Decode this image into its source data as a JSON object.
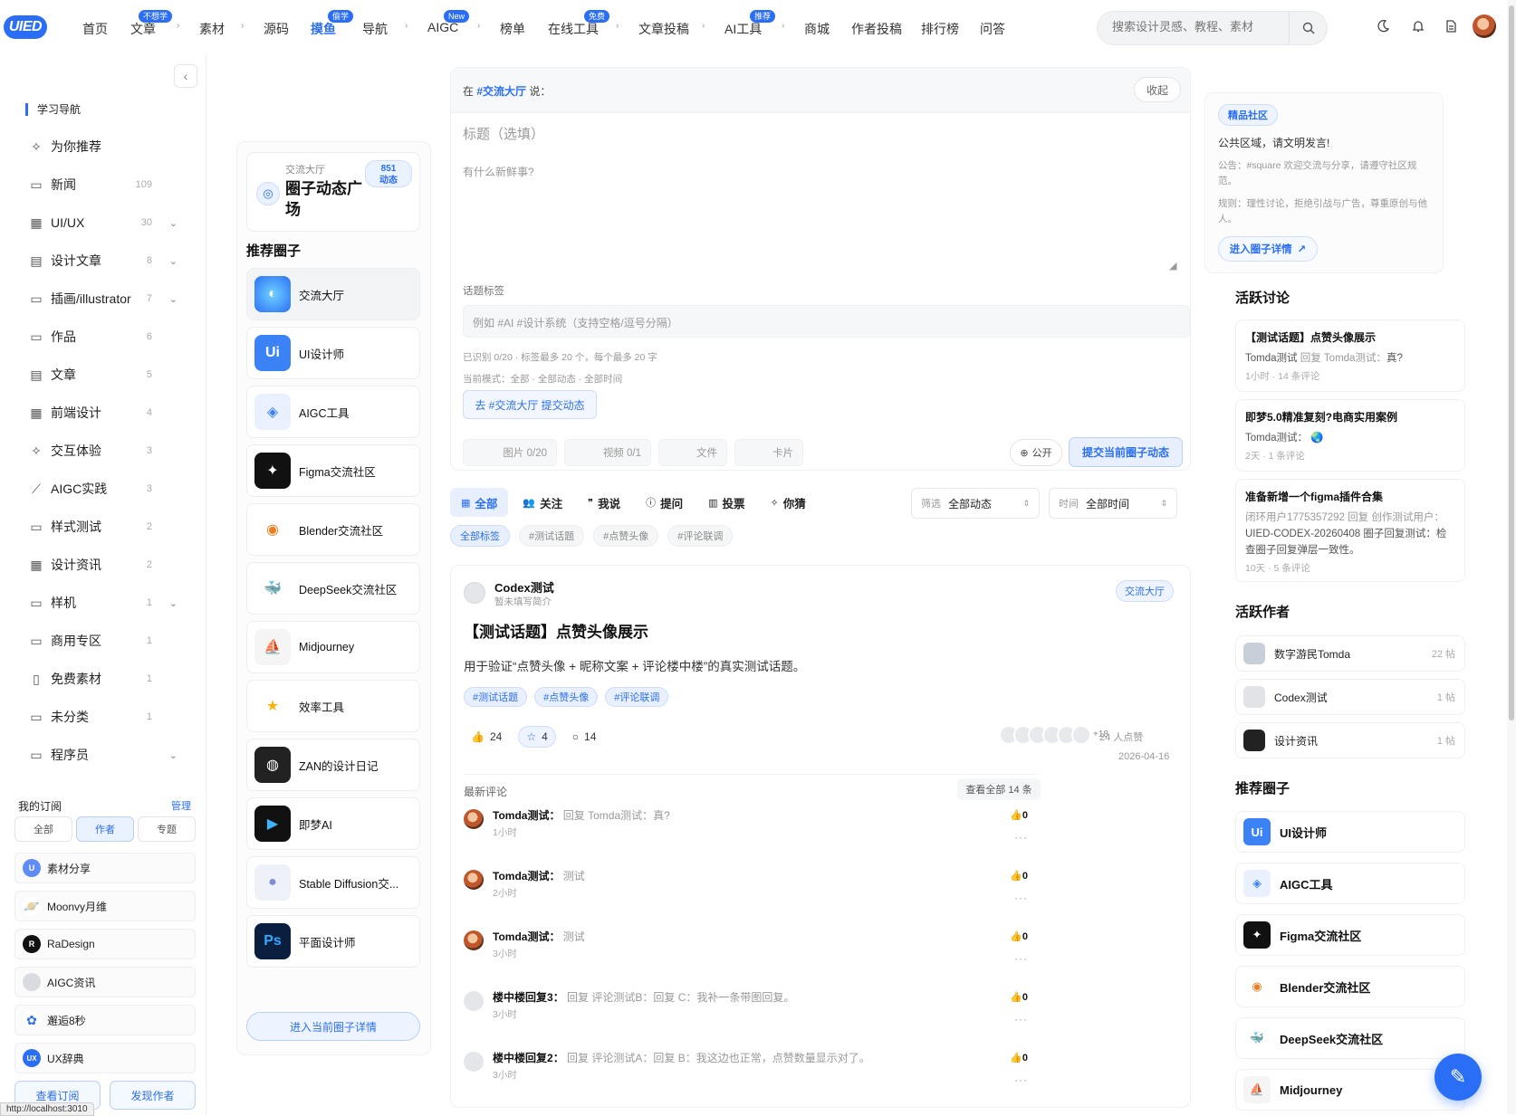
{
  "logo": "UIED",
  "nav": {
    "items": [
      "首页",
      "文章",
      "素材",
      "源码",
      "摸鱼",
      "导航",
      "AIGC",
      "榜单",
      "在线工具",
      "文章投稿",
      "AI工具",
      "商城",
      "作者投稿",
      "排行榜",
      "问答"
    ],
    "badges": {
      "article": "不想学",
      "moyu": "偷学",
      "aigc": "New",
      "tools": "免费",
      "ai": "推荐"
    },
    "search_placeholder": "搜索设计灵感、教程、素材"
  },
  "leftnav": {
    "title": "学习导航",
    "items": [
      {
        "label": "为你推荐",
        "count": "",
        "icon": "sparkle-icon"
      },
      {
        "label": "新闻",
        "count": "109",
        "icon": "folder-icon"
      },
      {
        "label": "UI/UX",
        "count": "30",
        "icon": "grid-icon"
      },
      {
        "label": "设计文章",
        "count": "8",
        "icon": "doc-icon"
      },
      {
        "label": "插画/illustrator",
        "count": "7",
        "icon": "folder-icon"
      },
      {
        "label": "作品",
        "count": "6",
        "icon": "folder-icon"
      },
      {
        "label": "文章",
        "count": "5",
        "icon": "doc-icon"
      },
      {
        "label": "前端设计",
        "count": "4",
        "icon": "grid-icon"
      },
      {
        "label": "交互体验",
        "count": "3",
        "icon": "sparkle-icon"
      },
      {
        "label": "AIGC实践",
        "count": "3",
        "icon": "wand-icon"
      },
      {
        "label": "样式测试",
        "count": "2",
        "icon": "folder-icon"
      },
      {
        "label": "设计资讯",
        "count": "2",
        "icon": "grid-icon"
      },
      {
        "label": "样机",
        "count": "1",
        "icon": "folder-icon"
      },
      {
        "label": "商用专区",
        "count": "1",
        "icon": "folder-icon"
      },
      {
        "label": "免费素材",
        "count": "1",
        "icon": "trash-icon"
      },
      {
        "label": "未分类",
        "count": "1",
        "icon": "folder-icon"
      },
      {
        "label": "程序员",
        "count": "",
        "icon": "folder-icon"
      }
    ]
  },
  "subscriptions": {
    "title": "我的订阅",
    "manage": "管理",
    "segments": [
      "全部",
      "作者",
      "专题"
    ],
    "items": [
      "素材分享",
      "Moonvy月维",
      "RaDesign",
      "AIGC资讯",
      "邂逅8秒",
      "UX辞典"
    ],
    "btn_view": "查看订阅",
    "btn_discover": "发现作者"
  },
  "status_url": "http://localhost:3010",
  "circle": {
    "small": "交流大厅",
    "name": "圈子动态广场",
    "count": "851",
    "count_label": "动态",
    "rec_title": "推荐圈子",
    "items": [
      "交流大厅",
      "UI设计师",
      "AIGC工具",
      "Figma交流社区",
      "Blender交流社区",
      "DeepSeek交流社区",
      "Midjourney",
      "效率工具",
      "ZAN的设计日记",
      "即梦AI",
      "Stable Diffusion交...",
      "平面设计师"
    ],
    "enter": "进入当前圈子详情"
  },
  "composer": {
    "say_prefix": "在",
    "say_tag": "#交流大厅",
    "say_suffix": "说：",
    "fold": "收起",
    "title_placeholder": "标题（选填）",
    "body_placeholder": "有什么新鲜事?",
    "tags_label": "话题标签",
    "tags_placeholder": "例如 #AI #设计系统（支持空格/逗号分隔）",
    "hint1": "已识别 0/20 · 标签最多 20 个，每个最多 20 字",
    "hint2": "当前模式：全部 · 全部动态 · 全部时间",
    "goto": "去 #交流大厅 提交动态",
    "tools": [
      "图片 0/20",
      "视频 0/1",
      "文件",
      "卡片"
    ],
    "visibility": "公开",
    "submit": "提交当前圈子动态"
  },
  "feed_tabs": [
    "全部",
    "关注",
    "我说",
    "提问",
    "投票",
    "你猜"
  ],
  "filters": {
    "filter_label": "筛选",
    "filter_value": "全部动态",
    "time_label": "时间",
    "time_value": "全部时间"
  },
  "tag_chips": [
    "全部标签",
    "#测试话题",
    "#点赞头像",
    "#评论联调"
  ],
  "post": {
    "author": "Codex测试",
    "bio": "暂未填写简介",
    "circle": "交流大厅",
    "title": "【测试话题】点赞头像展示",
    "desc": "用于验证“点赞头像 + 昵称文案 + 评论楼中楼”的真实测试话题。",
    "tags": [
      "#测试话题",
      "#点赞头像",
      "#评论联调"
    ],
    "likes": "24",
    "stars": "4",
    "comments": "14",
    "likers_more": "+18",
    "like_text": "24 人点赞",
    "date": "2026-04-16",
    "comment_head": "最新评论",
    "comment_all": "查看全部 14 条",
    "comment_list": [
      {
        "name": "Tomda测试",
        "text": "回复 Tomda测试：真?",
        "time": "1小时",
        "likes": "0"
      },
      {
        "name": "Tomda测试",
        "text": "测试",
        "time": "2小时",
        "likes": "0"
      },
      {
        "name": "Tomda测试",
        "text": "测试",
        "time": "3小时",
        "likes": "0"
      },
      {
        "name": "楼中楼回复3",
        "text": "回复 评论测试B：回复 C：我补一条带图回复。",
        "time": "3小时",
        "likes": "0"
      },
      {
        "name": "楼中楼回复2",
        "text": "回复 评论测试A：回复 B：我这边也正常，点赞数量显示对了。",
        "time": "3小时",
        "likes": "0"
      }
    ]
  },
  "right": {
    "badge": "精品社区",
    "public": "公共区域，请文明发言!",
    "announce": "公告：#square 欢迎交流与分享，请遵守社区规范。",
    "rule": "规则：理性讨论，拒绝引战与广告，尊重原创与他人。",
    "enter": "进入圈子详情",
    "disc_title": "活跃讨论",
    "discussions": [
      {
        "title": "【测试话题】点赞头像展示",
        "author": "Tomda测试",
        "reply": "回复 Tomda测试：",
        "content": "真?",
        "meta": "1小时 · 14 条评论"
      },
      {
        "title": "即梦5.0精准复刻?电商实用案例",
        "author": "Tomda测试：",
        "reply": "",
        "content": "",
        "meta": "2天 · 1 条评论"
      },
      {
        "title": "准备新增一个figma插件合集",
        "author": "闭环用户1775357292",
        "reply": "回复 创作测试用户：",
        "content": "UIED-CODEX-20260408 圈子回复测试：检查圈子回复弹层一致性。",
        "meta": "10天 · 5 条评论"
      }
    ],
    "authors_title": "活跃作者",
    "authors": [
      {
        "name": "数字游民Tomda",
        "count": "22 帖"
      },
      {
        "name": "Codex测试",
        "count": "1 帖"
      },
      {
        "name": "设计资讯",
        "count": "1 帖"
      }
    ],
    "rec_title": "推荐圈子",
    "rec": [
      "UI设计师",
      "AIGC工具",
      "Figma交流社区",
      "Blender交流社区",
      "DeepSeek交流社区",
      "Midjourney"
    ]
  },
  "colors": {
    "accent": "#2b6ef6"
  }
}
